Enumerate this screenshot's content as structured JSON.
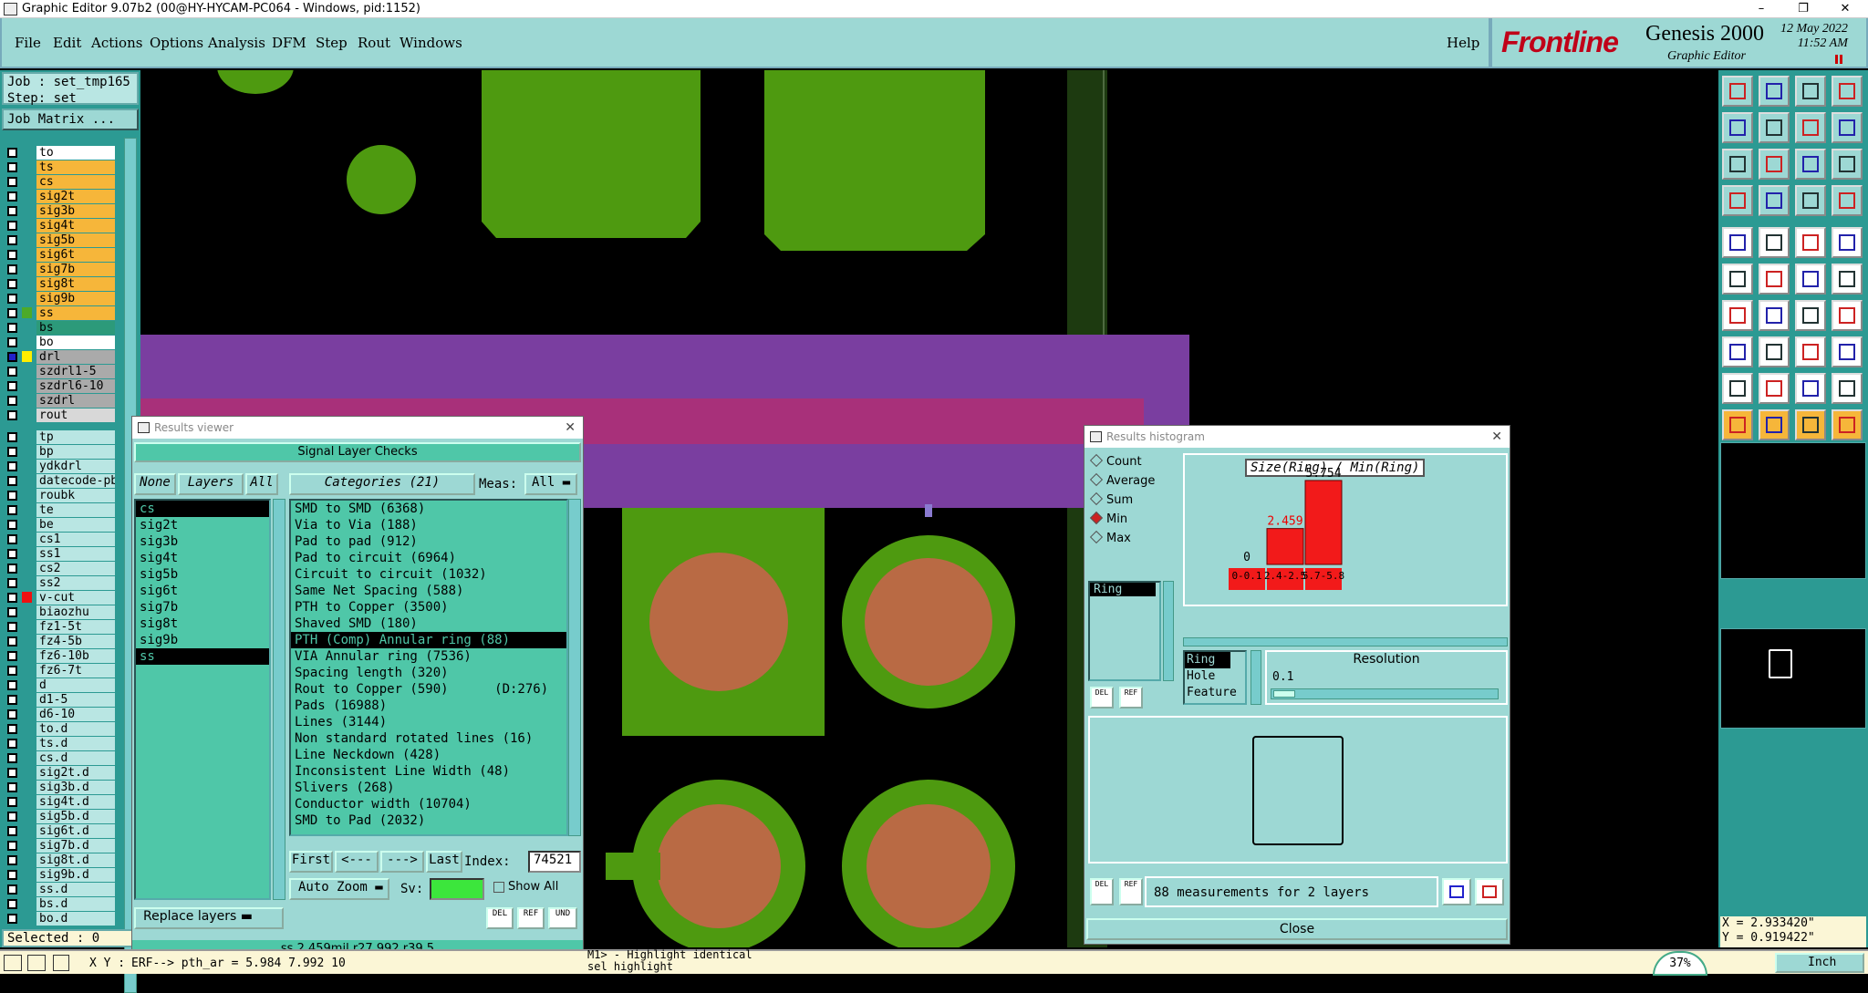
{
  "window": {
    "title": "Graphic Editor 9.07b2 (00@HY-HYCAM-PC064 - Windows, pid:1152)",
    "min": "–",
    "max": "❐",
    "close": "✕"
  },
  "menu": [
    "File",
    "Edit",
    "Actions",
    "Options",
    "Analysis",
    "DFM",
    "Step",
    "Rout",
    "Windows"
  ],
  "help": "Help",
  "brand": {
    "logo": "Frontline",
    "product": "Genesis 2000",
    "sub": "Graphic Editor",
    "date": "12 May 2022",
    "time": "11:52 AM"
  },
  "job": {
    "job": "Job : set_tmp165",
    "step": "Step: set",
    "matrix": "Job Matrix ..."
  },
  "layers_top": [
    {
      "name": "to",
      "bg": "#ffffff",
      "ind": ""
    },
    {
      "name": "ts",
      "bg": "#f6b63a",
      "ind": ""
    },
    {
      "name": "cs",
      "bg": "#f6b63a",
      "ind": ""
    },
    {
      "name": "sig2t",
      "bg": "#f6b63a",
      "ind": ""
    },
    {
      "name": "sig3b",
      "bg": "#f6b63a",
      "ind": ""
    },
    {
      "name": "sig4t",
      "bg": "#f6b63a",
      "ind": ""
    },
    {
      "name": "sig5b",
      "bg": "#f6b63a",
      "ind": ""
    },
    {
      "name": "sig6t",
      "bg": "#f6b63a",
      "ind": ""
    },
    {
      "name": "sig7b",
      "bg": "#f6b63a",
      "ind": ""
    },
    {
      "name": "sig8t",
      "bg": "#f6b63a",
      "ind": ""
    },
    {
      "name": "sig9b",
      "bg": "#f6b63a",
      "ind": ""
    },
    {
      "name": "ss",
      "bg": "#f6b63a",
      "ind": "#4caa2a"
    },
    {
      "name": "bs",
      "bg": "#2c9a7a",
      "ind": ""
    },
    {
      "name": "bo",
      "bg": "#ffffff",
      "ind": ""
    }
  ],
  "layers_mid": [
    {
      "name": "drl",
      "bg": "#aaaaaa",
      "ind": "#ffee00",
      "cb": true
    },
    {
      "name": "szdrl1-5",
      "bg": "#aaaaaa",
      "ind": ""
    },
    {
      "name": "szdrl6-10",
      "bg": "#aaaaaa",
      "ind": ""
    },
    {
      "name": "szdrl",
      "bg": "#aaaaaa",
      "ind": ""
    },
    {
      "name": "rout",
      "bg": "#d8d8d8",
      "ind": ""
    }
  ],
  "layers_bot": [
    {
      "name": "tp",
      "ind": ""
    },
    {
      "name": "bp",
      "ind": ""
    },
    {
      "name": "ydkdrl",
      "ind": ""
    },
    {
      "name": "datecode-pb",
      "ind": ""
    },
    {
      "name": "roubk",
      "ind": ""
    },
    {
      "name": "te",
      "ind": ""
    },
    {
      "name": "be",
      "ind": ""
    },
    {
      "name": "cs1",
      "ind": ""
    },
    {
      "name": "ss1",
      "ind": ""
    },
    {
      "name": "cs2",
      "ind": ""
    },
    {
      "name": "ss2",
      "ind": ""
    },
    {
      "name": "v-cut",
      "ind": "#ee1111"
    },
    {
      "name": "biaozhu",
      "ind": ""
    },
    {
      "name": "fz1-5t",
      "ind": ""
    },
    {
      "name": "fz4-5b",
      "ind": ""
    },
    {
      "name": "fz6-10b",
      "ind": ""
    },
    {
      "name": "fz6-7t",
      "ind": ""
    },
    {
      "name": "d",
      "ind": ""
    },
    {
      "name": "d1-5",
      "ind": ""
    },
    {
      "name": "d6-10",
      "ind": ""
    },
    {
      "name": "to.d",
      "ind": ""
    },
    {
      "name": "ts.d",
      "ind": ""
    },
    {
      "name": "cs.d",
      "ind": ""
    },
    {
      "name": "sig2t.d",
      "ind": ""
    },
    {
      "name": "sig3b.d",
      "ind": ""
    },
    {
      "name": "sig4t.d",
      "ind": ""
    },
    {
      "name": "sig5b.d",
      "ind": ""
    },
    {
      "name": "sig6t.d",
      "ind": ""
    },
    {
      "name": "sig7b.d",
      "ind": ""
    },
    {
      "name": "sig8t.d",
      "ind": ""
    },
    {
      "name": "sig9b.d",
      "ind": ""
    },
    {
      "name": "ss.d",
      "ind": ""
    },
    {
      "name": "bs.d",
      "ind": ""
    },
    {
      "name": "bo.d",
      "ind": ""
    }
  ],
  "selected": "Selected : 0",
  "results_viewer": {
    "title": "Results viewer",
    "header": "Signal Layer Checks",
    "none": "None",
    "layers": "Layers",
    "all": "All",
    "categories": "Categories (21)",
    "meas": "Meas:",
    "meas_val": "All",
    "layer_items": [
      "cs",
      "sig2t",
      "sig3b",
      "sig4t",
      "sig5b",
      "sig6t",
      "sig7b",
      "sig8t",
      "sig9b",
      "ss"
    ],
    "cat_items": [
      "SMD to SMD (6368)",
      "Via to Via (188)",
      "Pad to pad (912)",
      "Pad to circuit (6964)",
      "Circuit to circuit (1032)",
      "Same Net Spacing (588)",
      "PTH to Copper (3500)",
      "Shaved SMD (180)",
      "PTH (Comp) Annular ring (88)",
      "VIA Annular ring (7536)",
      "Spacing length (320)",
      "Rout to Copper (590)      (D:276)",
      "Pads (16988)",
      "Lines (3144)",
      "Non standard rotated lines (16)",
      "Line Neckdown (428)",
      "Inconsistent Line Width (48)",
      "Slivers (268)",
      "Conductor width (10704)",
      "SMD to Pad (2032)"
    ],
    "first": "First",
    "prev": "<---",
    "next": "--->",
    "last": "Last",
    "index": "Index:",
    "index_val": "74521",
    "autozoom": "Auto Zoom",
    "sv": "Sv:",
    "showall": "Show All",
    "replace": "Replace layers",
    "del": "DEL",
    "ref": "REF",
    "und": "UND",
    "status": "ss 2.459mil  r27.992  r39.5"
  },
  "histogram": {
    "title": "Results histogram",
    "options": [
      {
        "label": "Count",
        "on": false
      },
      {
        "label": "Average",
        "on": false
      },
      {
        "label": "Sum",
        "on": false
      },
      {
        "label": "Min",
        "on": true
      },
      {
        "label": "Max",
        "on": false
      }
    ],
    "chart_title": "Size(Ring) / Min(Ring)",
    "bins": [
      "0-\n0.1",
      "2.4-\n2.5",
      "5.7-\n5.8"
    ],
    "types": [
      "Ring",
      "Hole",
      "Feature"
    ],
    "resolution": "Resolution",
    "res_val": "0.1",
    "measurements": "88 measurements for 2 layers",
    "close": "Close",
    "ring_item": "Ring"
  },
  "chart_data": {
    "type": "bar",
    "title": "Size(Ring) / Min(Ring)",
    "categories": [
      "0-0.1",
      "2.4-2.5",
      "5.7-5.8"
    ],
    "values": [
      0,
      2.459,
      5.754
    ],
    "value_labels": [
      "0",
      "2.459",
      "5.754"
    ],
    "ylim": [
      0,
      6
    ]
  },
  "coords": {
    "x": "X = 2.933420\"",
    "y": "Y = 0.919422\""
  },
  "unit": "Inch",
  "status": {
    "xy": "X Y :",
    "cmd": "ERF--> pth_ar = 5.984 7.992 10",
    "m1": "M1> - Highlight identical",
    "m1b": "sel highlight",
    "zoom": "37%"
  }
}
